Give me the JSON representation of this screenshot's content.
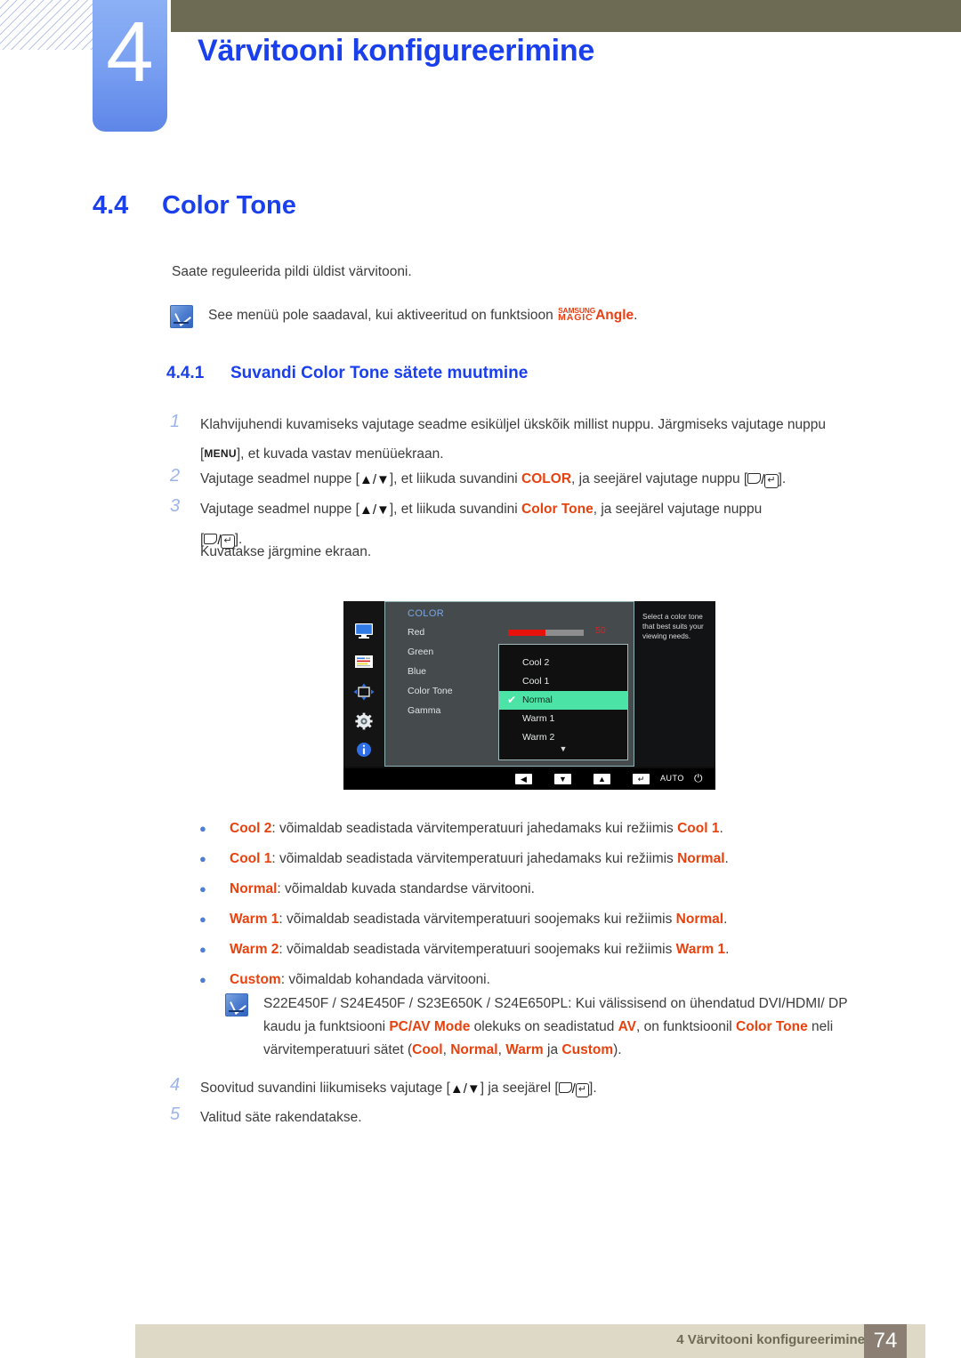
{
  "header": {
    "chapter_number": "4",
    "chapter_title": "Värvitooni konfigureerimine",
    "accent_blue": "#1a40ee",
    "olive": "#6e6b55"
  },
  "section": {
    "number": "4.4",
    "title": "Color Tone",
    "intro": "Saate reguleerida pildi üldist värvitooni."
  },
  "note1": {
    "text_before": "See menüü pole saadaval, kui aktiveeritud on funktsioon",
    "magic_top": "SAMSUNG",
    "magic_bottom": "MAGIC",
    "magic_word": "Angle",
    "text_after": "."
  },
  "subsection": {
    "number": "4.4.1",
    "title": "Suvandi Color Tone sätete muutmine"
  },
  "steps": {
    "s1_num": "1",
    "s1_part1": "Klahvijuhendi kuvamiseks vajutage seadme esiküljel ükskõik millist nuppu. Järgmiseks vajutage nuppu [",
    "s1_key": "MENU",
    "s1_part2": "], et kuvada vastav menüüekraan.",
    "s2_num": "2",
    "s2_part1": "Vajutage seadmel nuppe [",
    "s2_arrows": "▲/▼",
    "s2_part2": "], et liikuda suvandini ",
    "s2_hl": "COLOR",
    "s2_part3": ", ja seejärel vajutage nuppu [",
    "s2_part4": "].",
    "s3_num": "3",
    "s3_part1": "Vajutage seadmel nuppe [",
    "s3_arrows": "▲/▼",
    "s3_part2": "], et liikuda suvandini ",
    "s3_hl": "Color Tone",
    "s3_part3": ", ja seejärel vajutage nuppu",
    "s3_bracket_open": "[",
    "s3_bracket_close": "].",
    "s3_note": "Kuvatakse järgmine ekraan.",
    "s4_num": "4",
    "s4_part1": "Soovitud suvandini liikumiseks vajutage [",
    "s4_arrows": "▲/▼",
    "s4_part2": "] ja seejärel [",
    "s4_part3": "].",
    "s5_num": "5",
    "s5_text": "Valitud säte rakendatakse."
  },
  "osd": {
    "heading": "COLOR",
    "items": [
      "Red",
      "Green",
      "Blue",
      "Color Tone",
      "Gamma"
    ],
    "slider_value": "50",
    "slider_percent": 50,
    "dropdown": [
      {
        "label": "Cool 2",
        "selected": false
      },
      {
        "label": "Cool 1",
        "selected": false
      },
      {
        "label": "Normal",
        "selected": true
      },
      {
        "label": "Warm 1",
        "selected": false
      },
      {
        "label": "Warm 2",
        "selected": false
      }
    ],
    "scroll_arrow": "▼",
    "help_text": "Select a color tone that best suits your viewing needs.",
    "buttons": [
      "◀",
      "▼",
      "▲",
      "↵"
    ],
    "auto_label": "AUTO",
    "power_glyph": "⏻",
    "highlight_green": "#4ce4a6",
    "slider_red": "#e8120c"
  },
  "bullets": [
    {
      "term": "Cool 2",
      "mid": ": võimaldab seadistada värvitemperatuuri jahedamaks kui režiimis ",
      "term2": "Cool 1",
      "end": "."
    },
    {
      "term": "Cool 1",
      "mid": ": võimaldab seadistada värvitemperatuuri jahedamaks kui režiimis ",
      "term2": "Normal",
      "end": "."
    },
    {
      "term": "Normal",
      "mid": ": võimaldab kuvada standardse värvitooni.",
      "term2": "",
      "end": ""
    },
    {
      "term": "Warm 1",
      "mid": ": võimaldab seadistada värvitemperatuuri soojemaks kui režiimis ",
      "term2": "Normal",
      "end": "."
    },
    {
      "term": "Warm 2",
      "mid": ": võimaldab seadistada värvitemperatuuri soojemaks kui režiimis ",
      "term2": "Warm 1",
      "end": "."
    },
    {
      "term": "Custom",
      "mid": ": võimaldab kohandada värvitooni.",
      "term2": "",
      "end": ""
    }
  ],
  "note2": {
    "p1": "S22E450F / S24E450F / S23E650K / S24E650PL: Kui välissisend on ühendatud DVI/HDMI/ DP kaudu ja funktsiooni ",
    "hl1": "PC/AV Mode",
    "p2": " olekuks on seadistatud ",
    "hl2": "AV",
    "p3": ", on funktsioonil ",
    "hl3": "Color Tone",
    "p4": " neli värvitemperatuuri sätet (",
    "hl4": "Cool",
    "p5": ", ",
    "hl5": "Normal",
    "p6": ", ",
    "hl6": "Warm",
    "p7": " ja ",
    "hl7": "Custom",
    "p8": ")."
  },
  "footer": {
    "text": "4 Värvitooni konfigureerimine",
    "page": "74",
    "bar_color": "#ded8c6",
    "page_box_color": "#8a7f72"
  }
}
